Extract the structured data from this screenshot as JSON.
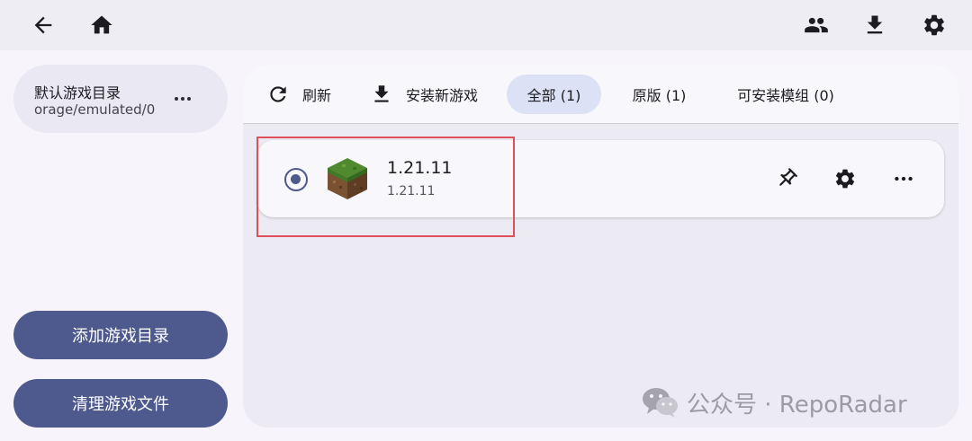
{
  "topbar": {
    "back_icon": "arrow-left-icon",
    "home_icon": "home-icon",
    "accounts_icon": "people-icon",
    "download_icon": "download-icon",
    "settings_icon": "gear-icon"
  },
  "sidebar": {
    "directory": {
      "title": "默认游戏目录",
      "path": "orage/emulated/0",
      "more_icon": "more-horizontal-icon"
    },
    "add_dir_label": "添加游戏目录",
    "clean_files_label": "清理游戏文件"
  },
  "toolbar": {
    "refresh_label": "刷新",
    "install_label": "安装新游戏",
    "filters": [
      {
        "label": "全部 (1)",
        "active": true
      },
      {
        "label": "原版 (1)",
        "active": false
      },
      {
        "label": "可安装模组 (0)",
        "active": false
      }
    ]
  },
  "versions": [
    {
      "name": "1.21.11",
      "subtitle": "1.21.11",
      "selected": true,
      "icon": "grass-block-icon"
    }
  ],
  "watermark": {
    "text": "公众号 · RepoRadar",
    "icon": "wechat-icon"
  },
  "colors": {
    "accent": "#4e5a8e",
    "active_filter": "#dde1f6",
    "highlight": "#e0505a"
  }
}
